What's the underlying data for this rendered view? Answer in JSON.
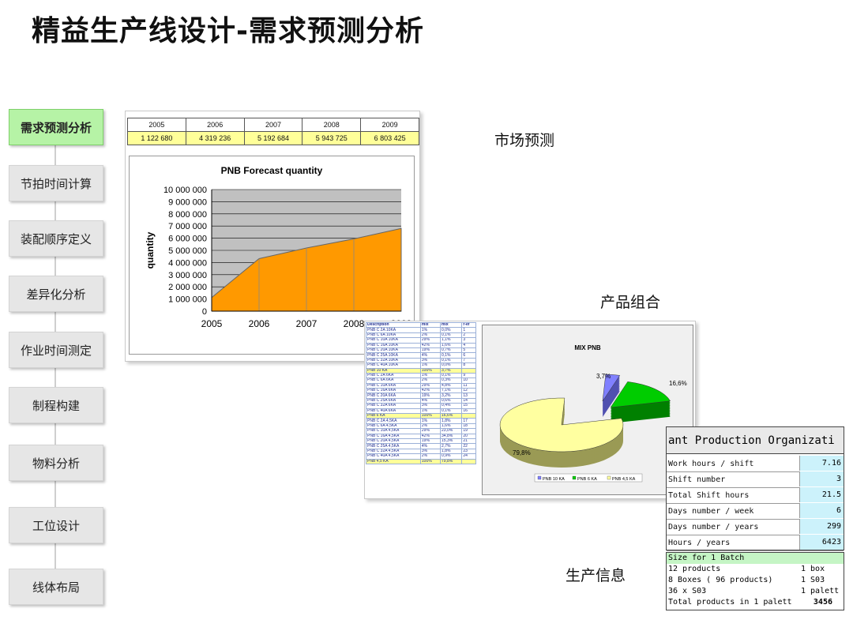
{
  "title": "精益生产线设计-需求预测分析",
  "nav": [
    {
      "label": "需求预测分析",
      "active": true
    },
    {
      "label": "节拍时间计算"
    },
    {
      "label": "装配顺序定义"
    },
    {
      "label": "差异化分析"
    },
    {
      "label": "作业时间测定"
    },
    {
      "label": "制程构建"
    },
    {
      "label": "物料分析"
    },
    {
      "label": "工位设计"
    },
    {
      "label": "线体布局"
    }
  ],
  "labels": {
    "market": "市场预测",
    "mix": "产品组合",
    "production": "生产信息"
  },
  "forecast": {
    "years": [
      "2005",
      "2006",
      "2007",
      "2008",
      "2009"
    ],
    "values": [
      "1 122 680",
      "4 319 236",
      "5 192 684",
      "5 943 725",
      "6 803 425"
    ]
  },
  "chart_data": [
    {
      "type": "area",
      "title": "PNB Forecast quantity",
      "ylabel": "quantity",
      "xlabel": "",
      "categories": [
        "2005",
        "2006",
        "2007",
        "2008",
        "2009"
      ],
      "values": [
        1122680,
        4319236,
        5192684,
        5943725,
        6803425
      ],
      "ylim": [
        0,
        10000000
      ],
      "yticks": [
        "0",
        "1 000 000",
        "2 000 000",
        "3 000 000",
        "4 000 000",
        "5 000 000",
        "6 000 000",
        "7 000 000",
        "8 000 000",
        "9 000 000",
        "10 000 000"
      ],
      "grid": true,
      "color": "#ff9900"
    },
    {
      "type": "pie",
      "title": "MIX PNB",
      "slices": [
        {
          "name": "PNB 10 KA",
          "value": 3.7,
          "label": "3,7%",
          "color": "#8080ff"
        },
        {
          "name": "PNB 6 KA",
          "value": 16.6,
          "label": "16,6%",
          "color": "#00cc00"
        },
        {
          "name": "PNB 4,5 KA",
          "value": 79.8,
          "label": "79,8%",
          "color": "#ffffa0"
        }
      ],
      "legend": "bottom"
    }
  ],
  "mix_table": [
    [
      "Description",
      "mix",
      "mix",
      "r-ef"
    ],
    [
      "PNB C 2A 10KA",
      "1%",
      "0,0%",
      "1"
    ],
    [
      "PNB C 6A 10KA",
      "2%",
      "0,1%",
      "2"
    ],
    [
      "PNB C 10A 10KA",
      "29%",
      "1,1%",
      "3"
    ],
    [
      "PNB C 16A 10KA",
      "42%",
      "1,6%",
      "4"
    ],
    [
      "PNB C 20A 10KA",
      "19%",
      "0,7%",
      "5"
    ],
    [
      "PNB C 25A 10KA",
      "4%",
      "0,1%",
      "6"
    ],
    [
      "PNB C 32A 10KA",
      "3%",
      "0,1%",
      "7"
    ],
    [
      "PNB C 40A 10KA",
      "1%",
      "0,0%",
      "8"
    ],
    [
      "PNB 10 KA",
      "100%",
      "3,7%",
      ""
    ],
    [
      "PNB C 2A 6KA",
      "1%",
      "0,1%",
      "9"
    ],
    [
      "PNB C 6A 6KA",
      "2%",
      "0,3%",
      "10"
    ],
    [
      "PNB C 10A 6KA",
      "29%",
      "4,8%",
      "11"
    ],
    [
      "PNB C 16A 6KA",
      "42%",
      "7,1%",
      "12"
    ],
    [
      "PNB C 20A 6KA",
      "19%",
      "3,2%",
      "13"
    ],
    [
      "PNB C 25A 6KA",
      "4%",
      "0,6%",
      "14"
    ],
    [
      "PNB C 32A 6KA",
      "3%",
      "0,4%",
      "15"
    ],
    [
      "PNB C 40A 6KA",
      "1%",
      "0,1%",
      "16"
    ],
    [
      "PNB 6 KA",
      "100%",
      "16,6%",
      ""
    ],
    [
      "PNB C 2A 4,5KA",
      "1%",
      "1,8%",
      "17"
    ],
    [
      "PNB C 6A 4,5KA",
      "2%",
      "1,6%",
      "18"
    ],
    [
      "PNB C 10A 4,5KA",
      "29%",
      "23,0%",
      "19"
    ],
    [
      "PNB C 16A 4,5KA",
      "42%",
      "34,8%",
      "20"
    ],
    [
      "PNB C 20A 4,5KA",
      "19%",
      "15,3%",
      "21"
    ],
    [
      "PNB C 25A 4,5KA",
      "4%",
      "2,7%",
      "22"
    ],
    [
      "PNB C 32A 4,5KA",
      "3%",
      "1,8%",
      "23"
    ],
    [
      "PNB C 40A 4,5KA",
      "2%",
      "0,9%",
      "24"
    ],
    [
      "PNB 4,5 KA",
      "100%",
      "79,8%",
      ""
    ]
  ],
  "production": {
    "header": "ant Production Organizati",
    "rows": [
      {
        "k": "Work hours / shift",
        "v": "7.16"
      },
      {
        "k": "Shift number",
        "v": "3"
      },
      {
        "k": "Total Shift hours",
        "v": "21.5"
      },
      {
        "k": "Days number / week",
        "v": "6"
      },
      {
        "k": "Days number / years",
        "v": "299"
      },
      {
        "k": "Hours / years",
        "v": "6423"
      }
    ],
    "batch": [
      {
        "a": "Size for 1 Batch",
        "b": "",
        "c": ""
      },
      {
        "a": "12 products",
        "b": "1 box",
        "c": ""
      },
      {
        "a": "8 Boxes ( 96 products)",
        "b": "1 S03",
        "c": ""
      },
      {
        "a": "36  x S03",
        "b": "1 palett",
        "c": ""
      },
      {
        "a": "Total products in 1 palett",
        "b": "",
        "c": "3456"
      }
    ]
  }
}
